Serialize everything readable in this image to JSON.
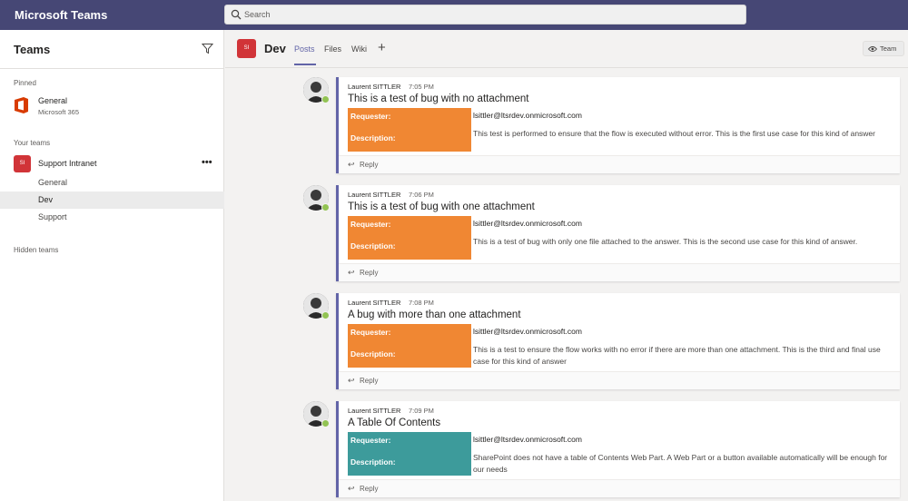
{
  "app": {
    "title": "Microsoft Teams"
  },
  "search": {
    "placeholder": "Search"
  },
  "sidebar": {
    "title": "Teams",
    "pinned_label": "Pinned",
    "pinned": {
      "name": "General",
      "sub": "Microsoft 365"
    },
    "your_teams_label": "Your teams",
    "team": {
      "avatar": "SI",
      "name": "Support Intranet"
    },
    "channels": [
      {
        "name": "General",
        "active": false
      },
      {
        "name": "Dev",
        "active": true
      },
      {
        "name": "Support",
        "active": false
      }
    ],
    "hidden_label": "Hidden teams"
  },
  "channel": {
    "avatar": "SI",
    "name": "Dev",
    "tabs": [
      "Posts",
      "Files",
      "Wiki"
    ],
    "team_button": "Team"
  },
  "posts": [
    {
      "author": "Laurent SITTLER",
      "time": "7:05 PM",
      "subject": "This is a test of bug with no attachment",
      "k1": "Requester:",
      "k2": "Description:",
      "email": "lsittler@ltsrdev.onmicrosoft.com",
      "desc": "This test is performed to ensure that the flow is executed without error. This is the first use case for this kind of answer",
      "reply": "Reply",
      "color": "#f08733"
    },
    {
      "author": "Laurent SITTLER",
      "time": "7:06 PM",
      "subject": "This is a test of bug with one attachment",
      "k1": "Requester:",
      "k2": "Description:",
      "email": "lsittler@ltsrdev.onmicrosoft.com",
      "desc": "This is a test of bug with only one file attached to the answer. This is the second use case for this kind of answer.",
      "reply": "Reply",
      "color": "#f08733"
    },
    {
      "author": "Laurent SITTLER",
      "time": "7:08 PM",
      "subject": "A bug with more than one attachment",
      "k1": "Requester:",
      "k2": "Description:",
      "email": "lsittler@ltsrdev.onmicrosoft.com",
      "desc": "This is a test to ensure the flow works with no error if there are more than one attachment. This is the third and final use case for this kind of answer",
      "reply": "Reply",
      "color": "#f08733"
    },
    {
      "author": "Laurent SITTLER",
      "time": "7:09 PM",
      "subject": "A Table Of Contents",
      "k1": "Requester:",
      "k2": "Description:",
      "email": "lsittler@ltsrdev.onmicrosoft.com",
      "desc": "SharePoint does not have a table of Contents Web Part. A Web Part or a button available automatically will be enough for our needs",
      "reply": "Reply",
      "color": "#3d9b9b"
    }
  ],
  "colors": {
    "header": "#464775",
    "accent": "#6264a7",
    "orange": "#f08733",
    "teal": "#3d9b9b",
    "presence": "#92c353"
  },
  "icons": [
    "search-icon",
    "filter-icon",
    "office-icon",
    "more-icon",
    "add-tab-icon",
    "eye-icon",
    "reply-icon",
    "presence-icon"
  ]
}
